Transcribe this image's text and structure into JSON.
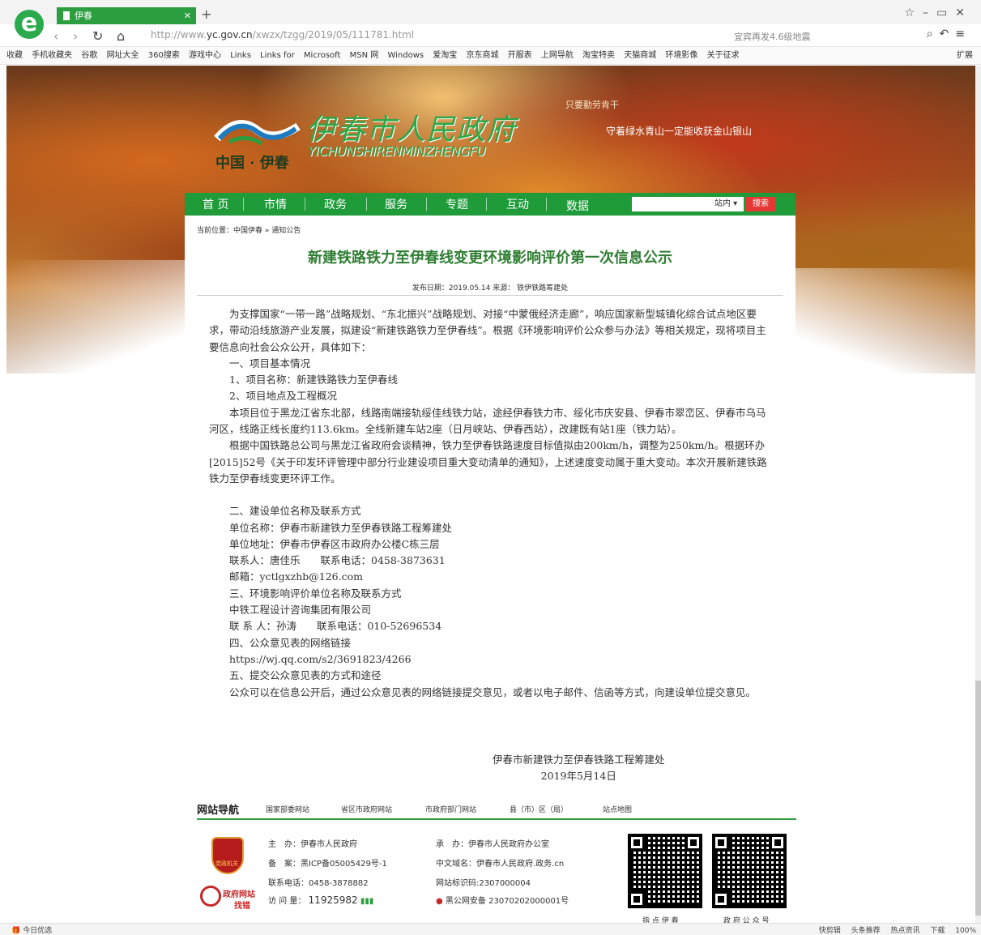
{
  "browser": {
    "tab_title": "伊春",
    "url_prefix": "http://www.",
    "url_domain": "yc.gov.cn",
    "url_path": "/xwzx/tzgg/2019/05/111781.html",
    "search_hint": "宜宾再发4.6级地震",
    "favorites": [
      "收藏",
      "手机收藏夹",
      "谷歌",
      "网址大全",
      "360搜索",
      "游戏中心",
      "Links",
      "Links for",
      "Microsoft",
      "MSN 网",
      "Windows",
      "爱淘宝",
      "京东商城",
      "开服表",
      "上网导航",
      "淘宝特卖",
      "天猫商城",
      "环境影像",
      "关于征求"
    ],
    "extensions_label": "扩展"
  },
  "site": {
    "title": "伊春市人民政府",
    "title_en": "YICHUNSHIRENMINZHENGFU",
    "title_cn": "中国 · 伊春",
    "slogan1": "只要勤劳肯干",
    "slogan2": "守着绿水青山一定能收获金山银山"
  },
  "nav": {
    "items": [
      "首 页",
      "市情",
      "政务",
      "服务",
      "专题",
      "互动",
      "数据"
    ],
    "scope": "站内",
    "search_button": "搜索"
  },
  "article": {
    "breadcrumb": "当前位置：中国伊春 » 通知公告",
    "title": "新建铁路铁力至伊春线变更环境影响评价第一次信息公示",
    "meta": "发布日期：2019.05.14 来源： 铁伊铁路筹建处",
    "paragraphs": [
      "为支撑国家“一带一路”战略规划、“东北振兴”战略规划、对接“中蒙俄经济走廊”，响应国家新型城镇化综合试点地区要求，带动沿线旅游产业发展，拟建设“新建铁路铁力至伊春线”。根据《环境影响评价公众参与办法》等相关规定，现将项目主要信息向社会公众公开，具体如下：",
      "一、项目基本情况",
      "1、项目名称：新建铁路铁力至伊春线",
      "2、项目地点及工程概况",
      "本项目位于黑龙江省东北部，线路南端接轨绥佳线铁力站，途经伊春铁力市、绥化市庆安县、伊春市翠峦区、伊春市乌马河区，线路正线长度约113.6km。全线新建车站2座（日月峡站、伊春西站），改建既有站1座（铁力站）。",
      "根据中国铁路总公司与黑龙江省政府会谈精神，铁力至伊春铁路速度目标值拟由200km/h，调整为250km/h。根据环办[2015]52号《关于印发环评管理中部分行业建设项目重大变动清单的通知》，上述速度变动属于重大变动。本次开展新建铁路铁力至伊春线变更环评工作。"
    ],
    "paragraphs2": [
      "二、建设单位名称及联系方式",
      "单位名称：伊春市新建铁力至伊春铁路工程筹建处",
      "单位地址：伊春市伊春区市政府办公楼C栋三层",
      "联系人：唐佳乐　　联系电话：0458-3873631",
      "邮箱：yctlgxzhb@126.com",
      "三、环境影响评价单位名称及联系方式",
      "中铁工程设计咨询集团有限公司",
      "联 系 人：孙涛　　联系电话：010-52696534",
      "四、公众意见表的网络链接",
      "https://wj.qq.com/s2/3691823/4266",
      "五、提交公众意见表的方式和途径",
      "公众可以在信息公开后，通过公众意见表的网络链接提交意见，或者以电子邮件、信函等方式，向建设单位提交意见。"
    ],
    "signature_org": "伊春市新建铁力至伊春铁路工程筹建处",
    "signature_date": "2019年5月14日"
  },
  "footer_nav": {
    "title": "网站导航",
    "links": [
      "国家部委网站",
      "省区市政府网站",
      "市政府部门网站",
      "县（市）区（局）",
      "站点地图"
    ]
  },
  "footer": {
    "badge_text": "党政机关",
    "zw_text1": "政府网站",
    "zw_text2": "找错",
    "sponsor": "主　办：伊春市人民政府",
    "icp": "备　案：黑ICP备05005429号-1",
    "phone": "联系电话：0458-3878882",
    "visits_label": "访 问 量：",
    "visits": "11925982",
    "host": "承　办：伊春市人民政府办公室",
    "cn_domain": "中文域名：伊春市人民政府.政务.cn",
    "site_id": "网站标识码:2307000004",
    "police": "黑公网安备 23070202000001号",
    "qr1_label": "指 点 伊 春",
    "qr2_label": "政 府 公 众 号"
  },
  "status": {
    "left": "今日优选",
    "right": [
      "快剪辑",
      "头条推荐",
      "热点资讯",
      "下载",
      "100%"
    ]
  }
}
